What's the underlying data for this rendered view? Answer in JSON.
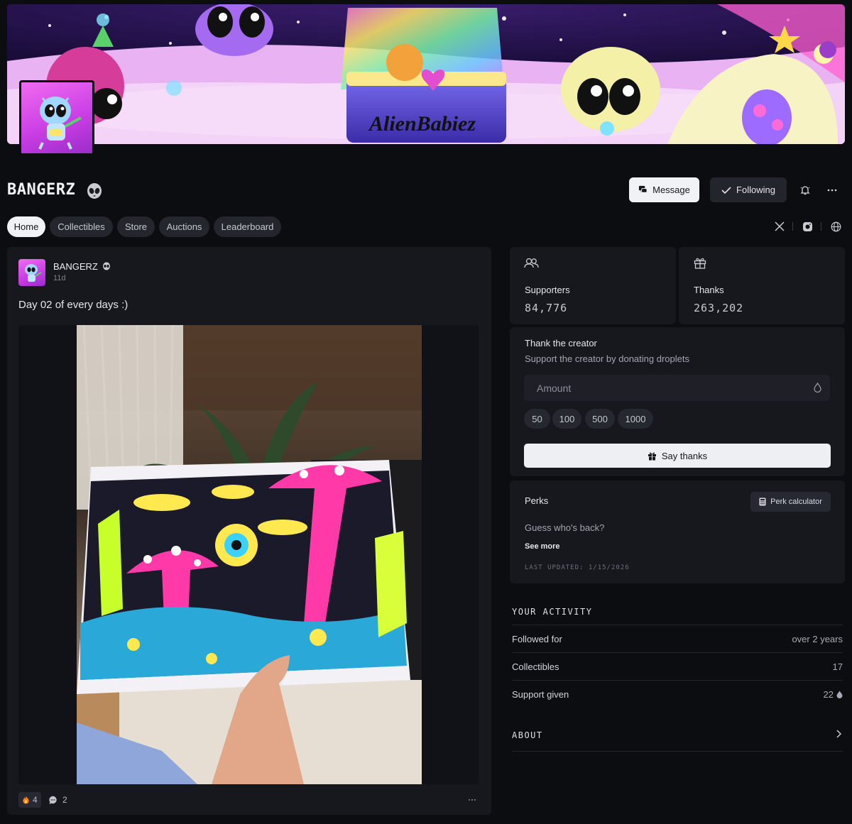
{
  "banner": {
    "logo_text": "AlienBabiez"
  },
  "creator": {
    "name": "BANGERZ"
  },
  "actions": {
    "message_label": "Message",
    "following_label": "Following"
  },
  "tabs": [
    {
      "label": "Home",
      "active": true
    },
    {
      "label": "Collectibles"
    },
    {
      "label": "Store"
    },
    {
      "label": "Auctions"
    },
    {
      "label": "Leaderboard"
    }
  ],
  "social_icons": [
    "x-icon",
    "instagram-icon",
    "globe-icon"
  ],
  "post": {
    "author": "BANGERZ",
    "time": "11d",
    "text": "Day 02 of every days :)",
    "reactions": {
      "fire_count": "4",
      "comment_count": "2"
    }
  },
  "stats": {
    "supporters_label": "Supporters",
    "supporters_value": "84,776",
    "thanks_label": "Thanks",
    "thanks_value": "263,202"
  },
  "thank_creator": {
    "title": "Thank the creator",
    "subtitle": "Support the creator by donating droplets",
    "amount_placeholder": "Amount",
    "presets": [
      "50",
      "100",
      "500",
      "1000"
    ],
    "button_label": "Say thanks"
  },
  "perks": {
    "title": "Perks",
    "calculator_label": "Perk calculator",
    "text": "Guess who's back?",
    "see_more": "See more",
    "last_updated": "LAST UPDATED: 1/15/2026"
  },
  "activity": {
    "title": "YOUR ACTIVITY",
    "rows": [
      {
        "label": "Followed for",
        "value": "over 2 years"
      },
      {
        "label": "Collectibles",
        "value": "17"
      },
      {
        "label": "Support given",
        "value": "22"
      }
    ]
  },
  "about": {
    "title": "ABOUT"
  },
  "colors": {
    "background": "#0c0d11",
    "panel": "#17181e",
    "button_light": "#f1f2f5",
    "button_dark": "#23252d"
  }
}
